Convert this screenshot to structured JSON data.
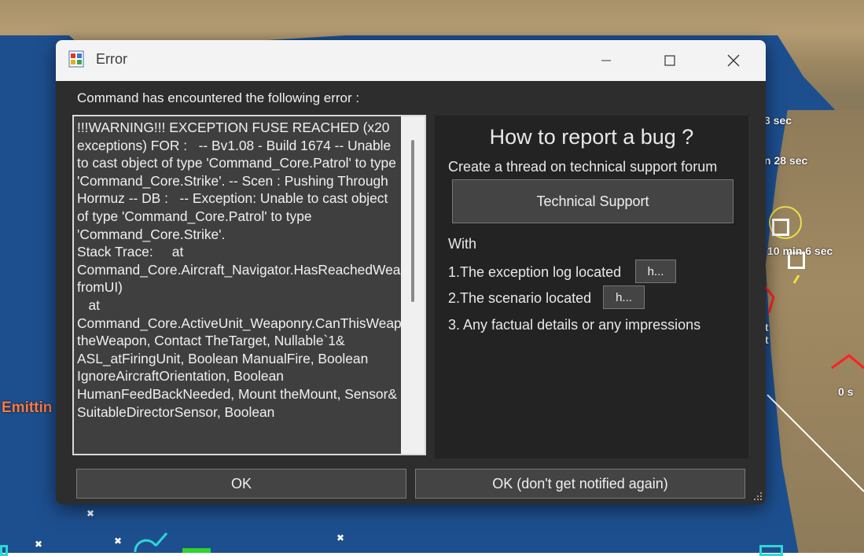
{
  "window": {
    "title": "Error",
    "controls": {
      "minimize": "minimize",
      "maximize": "maximize",
      "close": "close"
    }
  },
  "dialog": {
    "header": "Command has encountered the following error :",
    "log_text": "!!!WARNING!!! EXCEPTION FUSE REACHED (x20 exceptions) FOR :   -- Bv1.08 - Build 1674 -- Unable to cast object of type 'Command_Core.Patrol' to type 'Command_Core.Strike'. -- Scen : Pushing Through Hormuz -- DB :   -- Exception: Unable to cast object of type 'Command_Core.Patrol' to type 'Command_Core.Strike'.\nStack Trace:     at Command_Core.Aircraft_Navigator.HasReachedWeaponReleasePoint(Boolean fromUI)\n   at Command_Core.ActiveUnit_Weaponry.CanThisWeaponEngageThisTarget(Weapon theWeapon, Contact TheTarget, Nullable`1& ASL_atFiringUnit, Boolean ManualFire, Boolean IgnoreAircraftOrientation, Boolean HumanFeedBackNeeded, Mount theMount, Sensor& SuitableDirectorSensor, Boolean",
    "report": {
      "title": "How to report a bug ?",
      "subtitle": "Create a thread on technical support forum",
      "tech_support_label": "Technical Support",
      "with_label": "With",
      "item1": "1.The exception log located",
      "item1_btn": "h...",
      "item2": "2.The scenario located",
      "item2_btn": "h...",
      "item3": "3. Any factual details or any impressions"
    },
    "ok_label": "OK",
    "ok_dont_notify_label": "OK (don't get notified again)"
  },
  "map": {
    "emitting_label": "Emittin",
    "labels": [
      "3 sec",
      "n 28 sec",
      "10 min 6 sec",
      "t",
      "t",
      "0 s"
    ]
  },
  "colors": {
    "dialog_bg": "#2d2d2d",
    "titlebar_bg": "#f3f3f3",
    "sea": "#1d4f8f",
    "emitting": "#ff7a3c"
  }
}
